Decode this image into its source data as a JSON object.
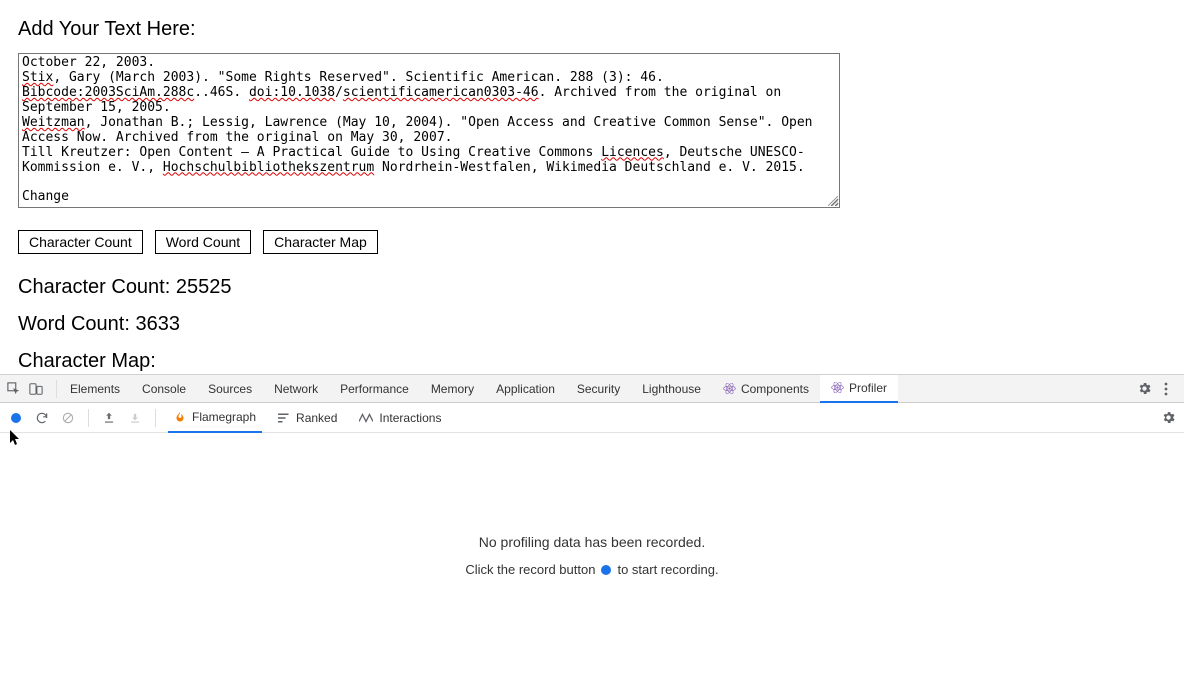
{
  "page": {
    "heading": "Add Your Text Here:",
    "textarea_lines": [
      {
        "segs": [
          {
            "t": "October 22, 2003."
          }
        ]
      },
      {
        "segs": [
          {
            "t": "Stix",
            "u": true
          },
          {
            "t": ", Gary (March 2003). \"Some Rights Reserved\". Scientific American. 288 (3): 46. "
          }
        ]
      },
      {
        "segs": [
          {
            "t": "Bibcode:2003SciAm.288c",
            "u": true
          },
          {
            "t": "..46S. "
          },
          {
            "t": "doi:10.1038",
            "u": true
          },
          {
            "t": "/"
          },
          {
            "t": "scientificamerican0303-46",
            "u": true
          },
          {
            "t": ". Archived from the original on "
          }
        ]
      },
      {
        "segs": [
          {
            "t": "September 15, 2005."
          }
        ]
      },
      {
        "segs": [
          {
            "t": "Weitzman",
            "u": true
          },
          {
            "t": ", Jonathan B.; Lessig, Lawrence (May 10, 2004). \"Open Access and Creative Common Sense\". Open "
          }
        ]
      },
      {
        "segs": [
          {
            "t": "Access Now. Archived from the original on May 30, 2007."
          }
        ]
      },
      {
        "segs": [
          {
            "t": "Till Kreutzer: Open Content – A Practical Guide to Using Creative Commons "
          },
          {
            "t": "Licences",
            "u": true
          },
          {
            "t": ", Deutsche UNESCO-"
          }
        ]
      },
      {
        "segs": [
          {
            "t": "Kommission e. V., "
          },
          {
            "t": "Hochschulbibliothekszentrum",
            "u": true
          },
          {
            "t": " Nordrhein-Westfalen, Wikimedia Deutschland e. V. 2015."
          }
        ]
      },
      {
        "segs": [
          {
            "t": ""
          }
        ]
      },
      {
        "segs": [
          {
            "t": "Change"
          }
        ]
      }
    ],
    "buttons": {
      "char_count": "Character Count",
      "word_count": "Word Count",
      "char_map": "Character Map"
    },
    "results": {
      "char_count_label": "Character Count:",
      "char_count_value": "25525",
      "word_count_label": "Word Count:",
      "word_count_value": "3633",
      "char_map_label": "Character Map:"
    }
  },
  "devtools": {
    "tabs": [
      "Elements",
      "Console",
      "Sources",
      "Network",
      "Performance",
      "Memory",
      "Application",
      "Security",
      "Lighthouse",
      "Components",
      "Profiler"
    ],
    "active_tab": "Profiler",
    "react_tabs": [
      "Components",
      "Profiler"
    ],
    "sub_tabs": {
      "flamegraph": "Flamegraph",
      "ranked": "Ranked",
      "interactions": "Interactions"
    },
    "active_sub": "Flamegraph",
    "body": {
      "main": "No profiling data has been recorded.",
      "sub_pre": "Click the record button",
      "sub_post": "to start recording."
    }
  },
  "colors": {
    "accent": "#1a73e8",
    "react": "#8861b7",
    "rec": "#1a73e8"
  }
}
